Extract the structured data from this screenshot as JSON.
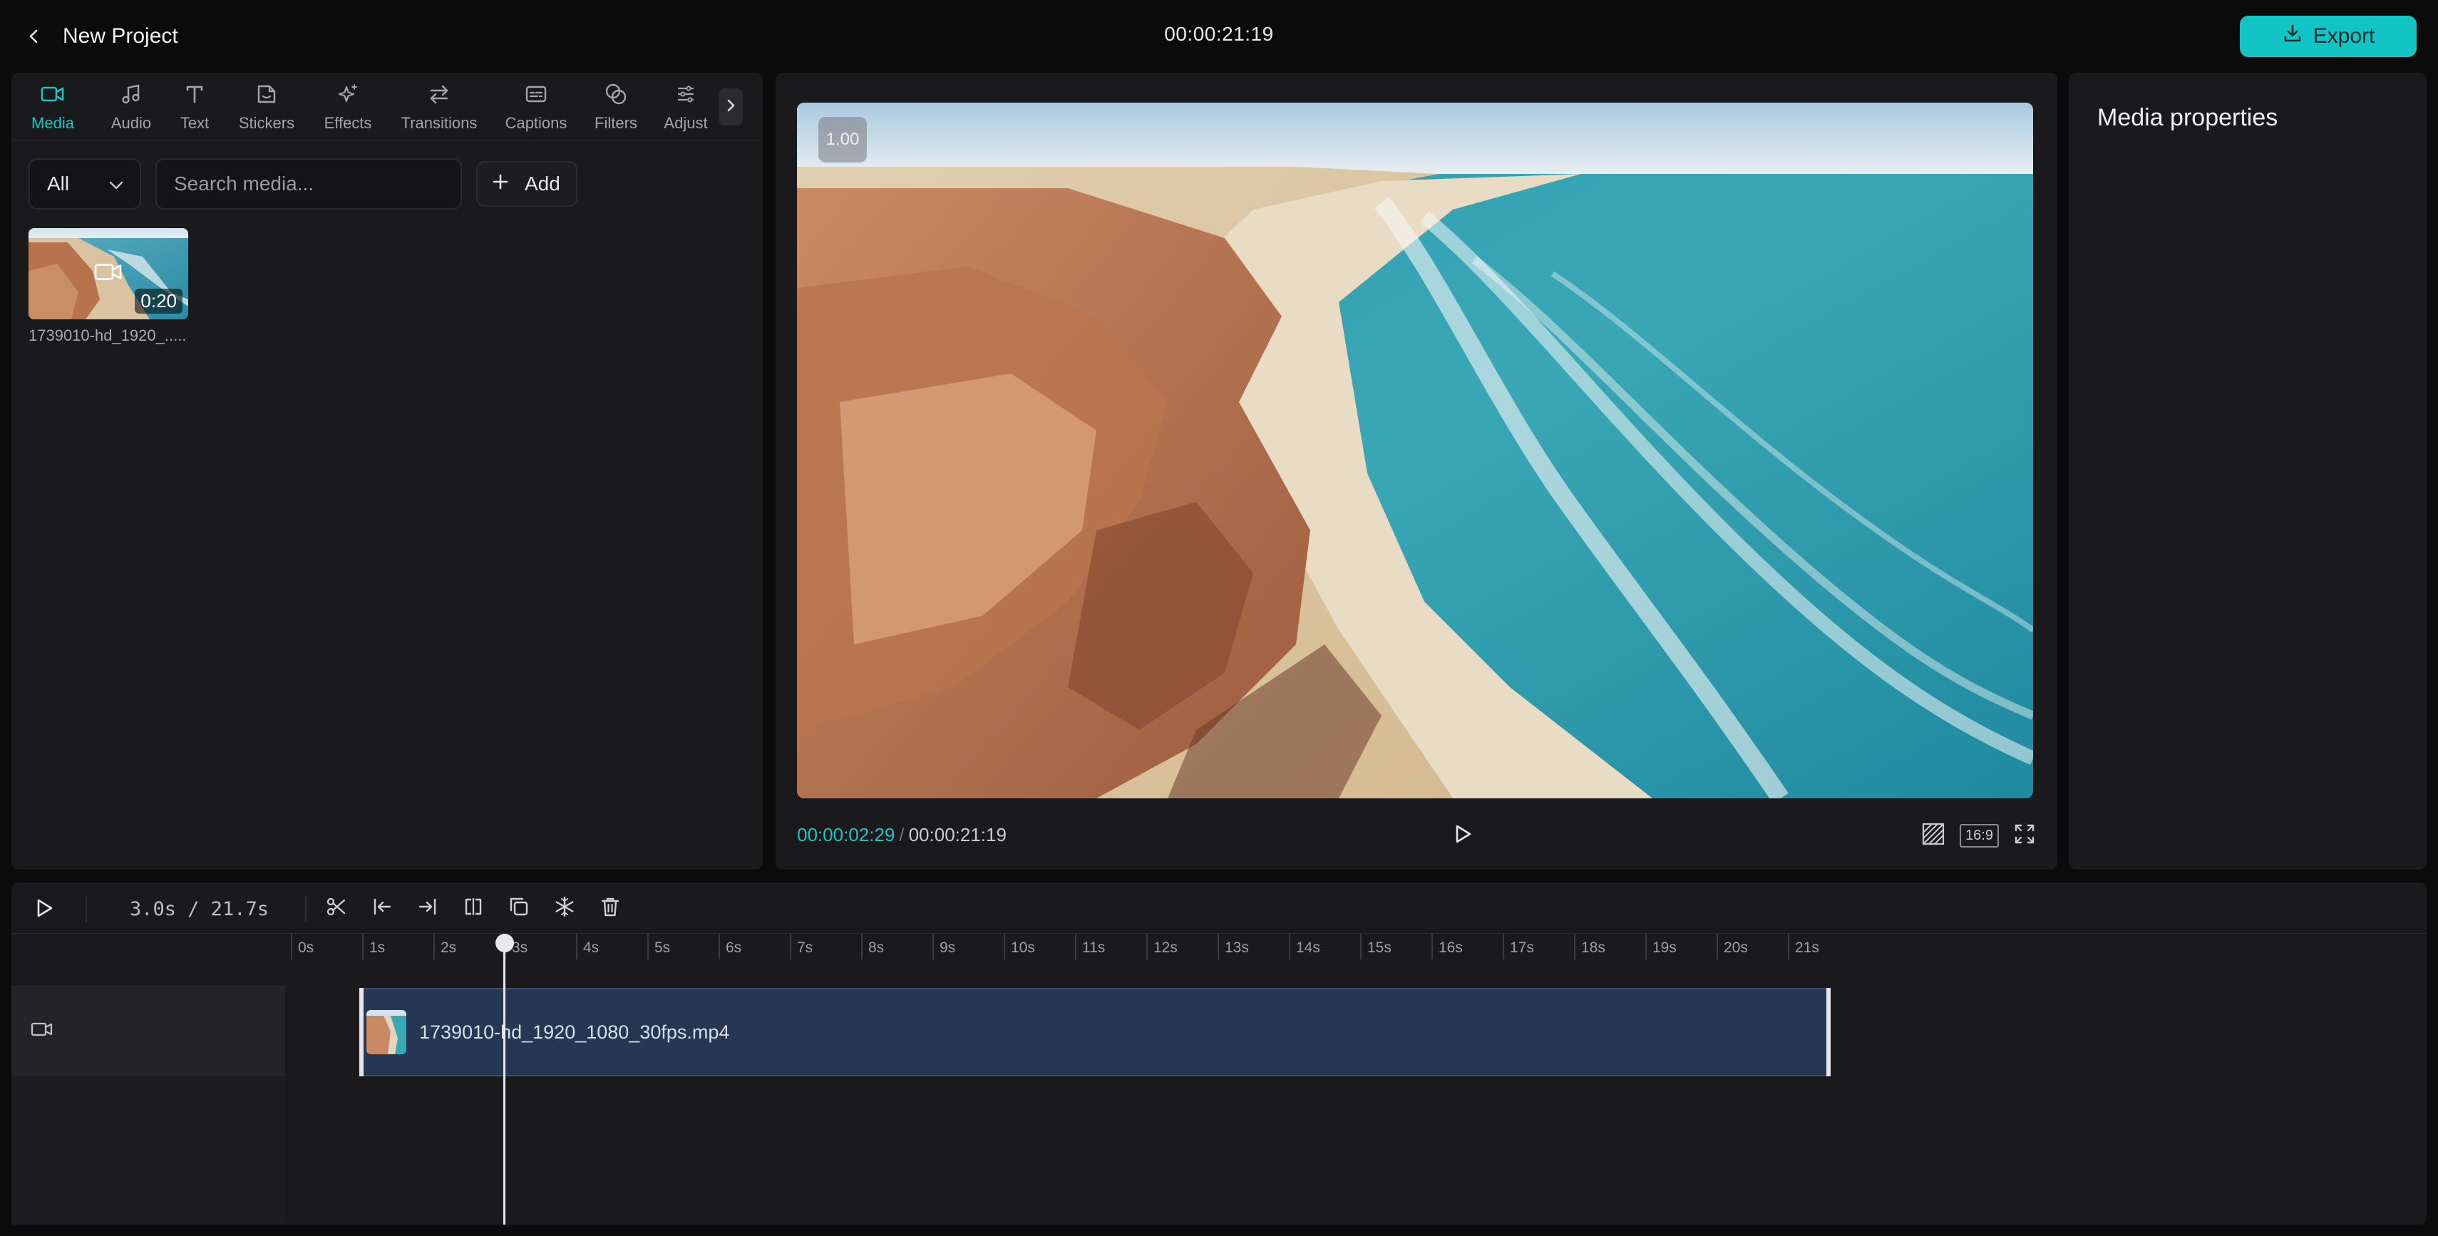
{
  "header": {
    "project_title": "New Project",
    "duration": "00:00:21:19",
    "export_label": "Export"
  },
  "left_panel": {
    "tabs": [
      {
        "label": "Media",
        "icon": "video-icon",
        "active": true
      },
      {
        "label": "Audio",
        "icon": "music-note-icon"
      },
      {
        "label": "Text",
        "icon": "text-icon"
      },
      {
        "label": "Stickers",
        "icon": "sticker-icon"
      },
      {
        "label": "Effects",
        "icon": "sparkle-icon"
      },
      {
        "label": "Transitions",
        "icon": "transition-arrows-icon"
      },
      {
        "label": "Captions",
        "icon": "captions-icon"
      },
      {
        "label": "Filters",
        "icon": "filters-icon"
      },
      {
        "label": "Adjust",
        "icon": "adjust-sliders-icon"
      }
    ],
    "filter": {
      "selected": "All"
    },
    "search": {
      "placeholder": "Search media..."
    },
    "add_label": "Add",
    "media_items": [
      {
        "name": "1739010-hd_1920_.....",
        "duration": "0:20"
      }
    ]
  },
  "preview": {
    "scale": "1.00",
    "current_time": "00:00:02:29",
    "separator": "/",
    "total_time": "00:00:21:19",
    "aspect_ratio": "16:9"
  },
  "properties": {
    "title": "Media properties"
  },
  "timeline": {
    "time_readout": "3.0s / 21.7s",
    "ruler_labels": [
      "0s",
      "1s",
      "2s",
      "3s",
      "4s",
      "5s",
      "6s",
      "7s",
      "8s",
      "9s",
      "10s",
      "11s",
      "12s",
      "13s",
      "14s",
      "15s",
      "16s",
      "17s",
      "18s",
      "19s",
      "20s",
      "21s"
    ],
    "clip_name": "1739010-hd_1920_1080_30fps.mp4",
    "playhead_seconds": 3.0,
    "total_seconds": 21.7
  },
  "colors": {
    "accent": "#12c4c4",
    "background": "#0b0b0c",
    "panel": "#1a1a1c",
    "clip": "#263754"
  }
}
